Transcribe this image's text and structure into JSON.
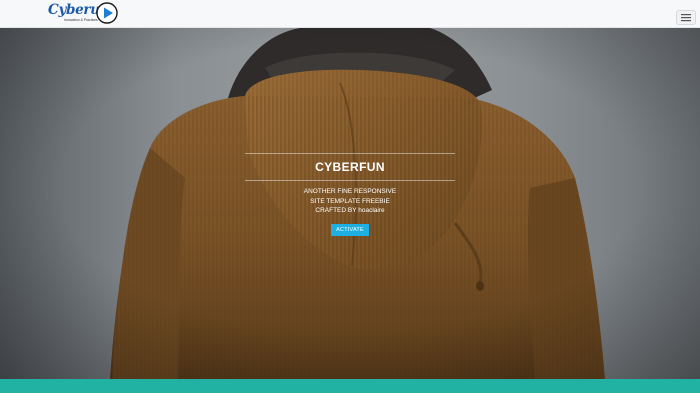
{
  "brand": {
    "name": "Cyberun",
    "tagline": "Innovation & Practices"
  },
  "nav": {
    "menu_icon": "hamburger-icon"
  },
  "hero": {
    "title": "CYBERFUN",
    "subtitle_lines": [
      "ANOTHER FINE RESPONSIVE",
      "SITE TEMPLATE FREEBIE",
      "CRAFTED BY hoaclaire"
    ],
    "button_label": "ACTIVATE",
    "background": "photo of person in brown corduroy hooded jacket seen from behind"
  },
  "colors": {
    "accent_button": "#1fb0e3",
    "bottom_band": "#21b2a4",
    "logo_blue": "#1d5aa6"
  }
}
